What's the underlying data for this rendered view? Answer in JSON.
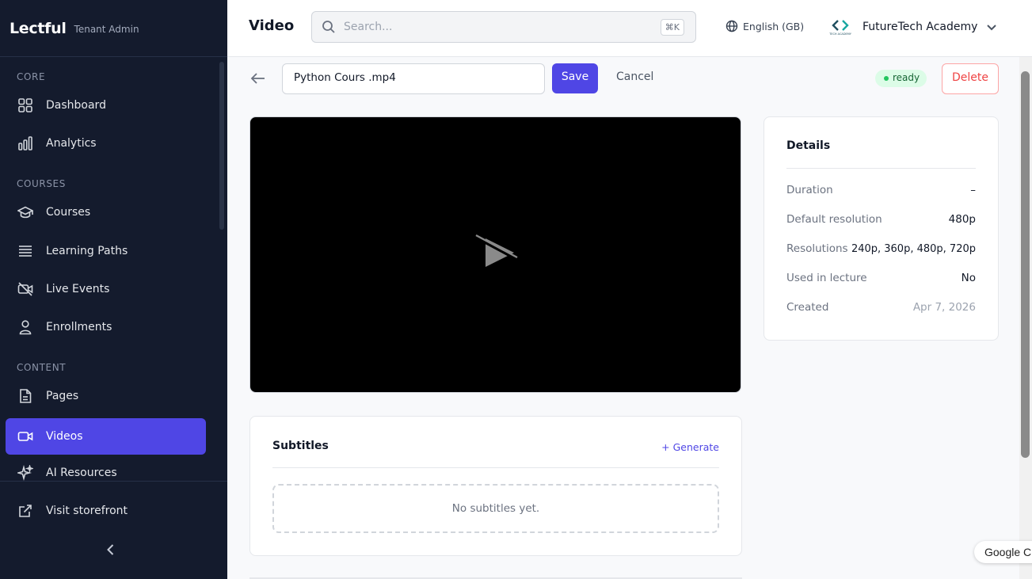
{
  "brand": {
    "name": "Lectful",
    "subtitle": "Tenant Admin"
  },
  "sidebar": {
    "sections": [
      {
        "label": "CORE"
      },
      {
        "label": "COURSES"
      },
      {
        "label": "CONTENT"
      }
    ],
    "items": [
      {
        "label": "Dashboard",
        "icon": "grid-icon",
        "active": false
      },
      {
        "label": "Analytics",
        "icon": "bar-chart-icon",
        "active": false
      },
      {
        "label": "Courses",
        "icon": "graduation-cap-icon",
        "active": false
      },
      {
        "label": "Learning Paths",
        "icon": "layers-icon",
        "active": false
      },
      {
        "label": "Live Events",
        "icon": "video-off-icon",
        "active": false
      },
      {
        "label": "Enrollments",
        "icon": "user-icon",
        "active": false
      },
      {
        "label": "Pages",
        "icon": "file-icon",
        "active": false
      },
      {
        "label": "Videos",
        "icon": "video-icon",
        "active": true
      },
      {
        "label": "AI Resources",
        "icon": "sparkles-icon",
        "active": false
      }
    ],
    "footer": {
      "storefront_label": "Visit storefront",
      "collapse_icon": "chevron-left-icon"
    }
  },
  "header": {
    "title": "Video",
    "search": {
      "placeholder": "Search...",
      "shortcut": "⌘K"
    },
    "language": "English (GB)",
    "org": {
      "name": "FutureTech Academy",
      "logo_text": "TECH ACADEMY"
    }
  },
  "editor": {
    "title_value": "Python Cours .mp4",
    "save_label": "Save",
    "cancel_label": "Cancel",
    "status": "ready",
    "delete_label": "Delete"
  },
  "details": {
    "title": "Details",
    "rows": [
      {
        "key": "Duration",
        "value": "–"
      },
      {
        "key": "Default resolution",
        "value": "480p"
      },
      {
        "key": "Resolutions",
        "value": "240p, 360p, 480p, 720p"
      },
      {
        "key": "Used in lecture",
        "value": "No"
      },
      {
        "key": "Created",
        "value": "Apr 7, 2026"
      }
    ]
  },
  "subtitles": {
    "title": "Subtitles",
    "generate_label": "+ Generate",
    "empty_text": "No subtitles yet."
  },
  "widgets": {
    "google_translate": "Google C"
  },
  "colors": {
    "accent": "#4f46e5",
    "sidebar_bg": "#141b2d",
    "success": "#22c55e",
    "danger": "#ef4444"
  }
}
